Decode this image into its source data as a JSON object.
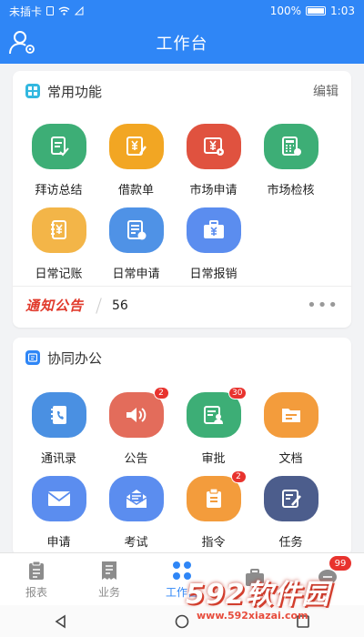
{
  "status_bar": {
    "carrier": "未插卡",
    "battery": "100%",
    "time": "1:03"
  },
  "header": {
    "title": "工作台"
  },
  "common": {
    "title": "常用功能",
    "edit_label": "编辑",
    "items": [
      {
        "label": "拜访总结",
        "icon": "document-check-icon",
        "color": "#3dae76"
      },
      {
        "label": "借款单",
        "icon": "yuan-pen-icon",
        "color": "#f2a623"
      },
      {
        "label": "市场申请",
        "icon": "yuan-play-icon",
        "color": "#e0523f"
      },
      {
        "label": "市场检核",
        "icon": "calculator-icon",
        "color": "#3dae76"
      },
      {
        "label": "日常记账",
        "icon": "ledger-icon",
        "color": "#f3b548"
      },
      {
        "label": "日常申请",
        "icon": "form-yuan-icon",
        "color": "#4f92e6"
      },
      {
        "label": "日常报销",
        "icon": "briefcase-yuan-icon",
        "color": "#5b8def"
      }
    ],
    "notice": {
      "brand": "通知公告",
      "count": "56",
      "more": "•••"
    }
  },
  "collab": {
    "title": "协同办公",
    "items": [
      {
        "label": "通讯录",
        "icon": "contacts-icon",
        "color": "#4a90e2",
        "badge": ""
      },
      {
        "label": "公告",
        "icon": "speaker-icon",
        "color": "#e36c5b",
        "badge": "2"
      },
      {
        "label": "审批",
        "icon": "approval-icon",
        "color": "#3dae76",
        "badge": "30"
      },
      {
        "label": "文档",
        "icon": "folder-icon",
        "color": "#f39c3c",
        "badge": ""
      },
      {
        "label": "申请",
        "icon": "envelope-icon",
        "color": "#5b8def",
        "badge": ""
      },
      {
        "label": "考试",
        "icon": "open-envelope-icon",
        "color": "#5b8def",
        "badge": ""
      },
      {
        "label": "指令",
        "icon": "clipboard-icon",
        "color": "#f39c3c",
        "badge": "2"
      },
      {
        "label": "任务",
        "icon": "task-edit-icon",
        "color": "#4c5d8c",
        "badge": ""
      }
    ]
  },
  "tabs": [
    {
      "label": "报表",
      "icon": "report-icon",
      "active": false,
      "badge": ""
    },
    {
      "label": "业务",
      "icon": "receipt-icon",
      "active": false,
      "badge": ""
    },
    {
      "label": "工作台",
      "icon": "grid-icon",
      "active": true,
      "badge": ""
    },
    {
      "label": "",
      "icon": "briefcase-icon",
      "active": false,
      "badge": ""
    },
    {
      "label": "",
      "icon": "chat-icon",
      "active": false,
      "badge": "99"
    }
  ],
  "watermark": {
    "text": "592软件园",
    "url": "www.592xiazai.com"
  },
  "colors": {
    "primary": "#2f86f6",
    "badge": "#e8332e"
  }
}
